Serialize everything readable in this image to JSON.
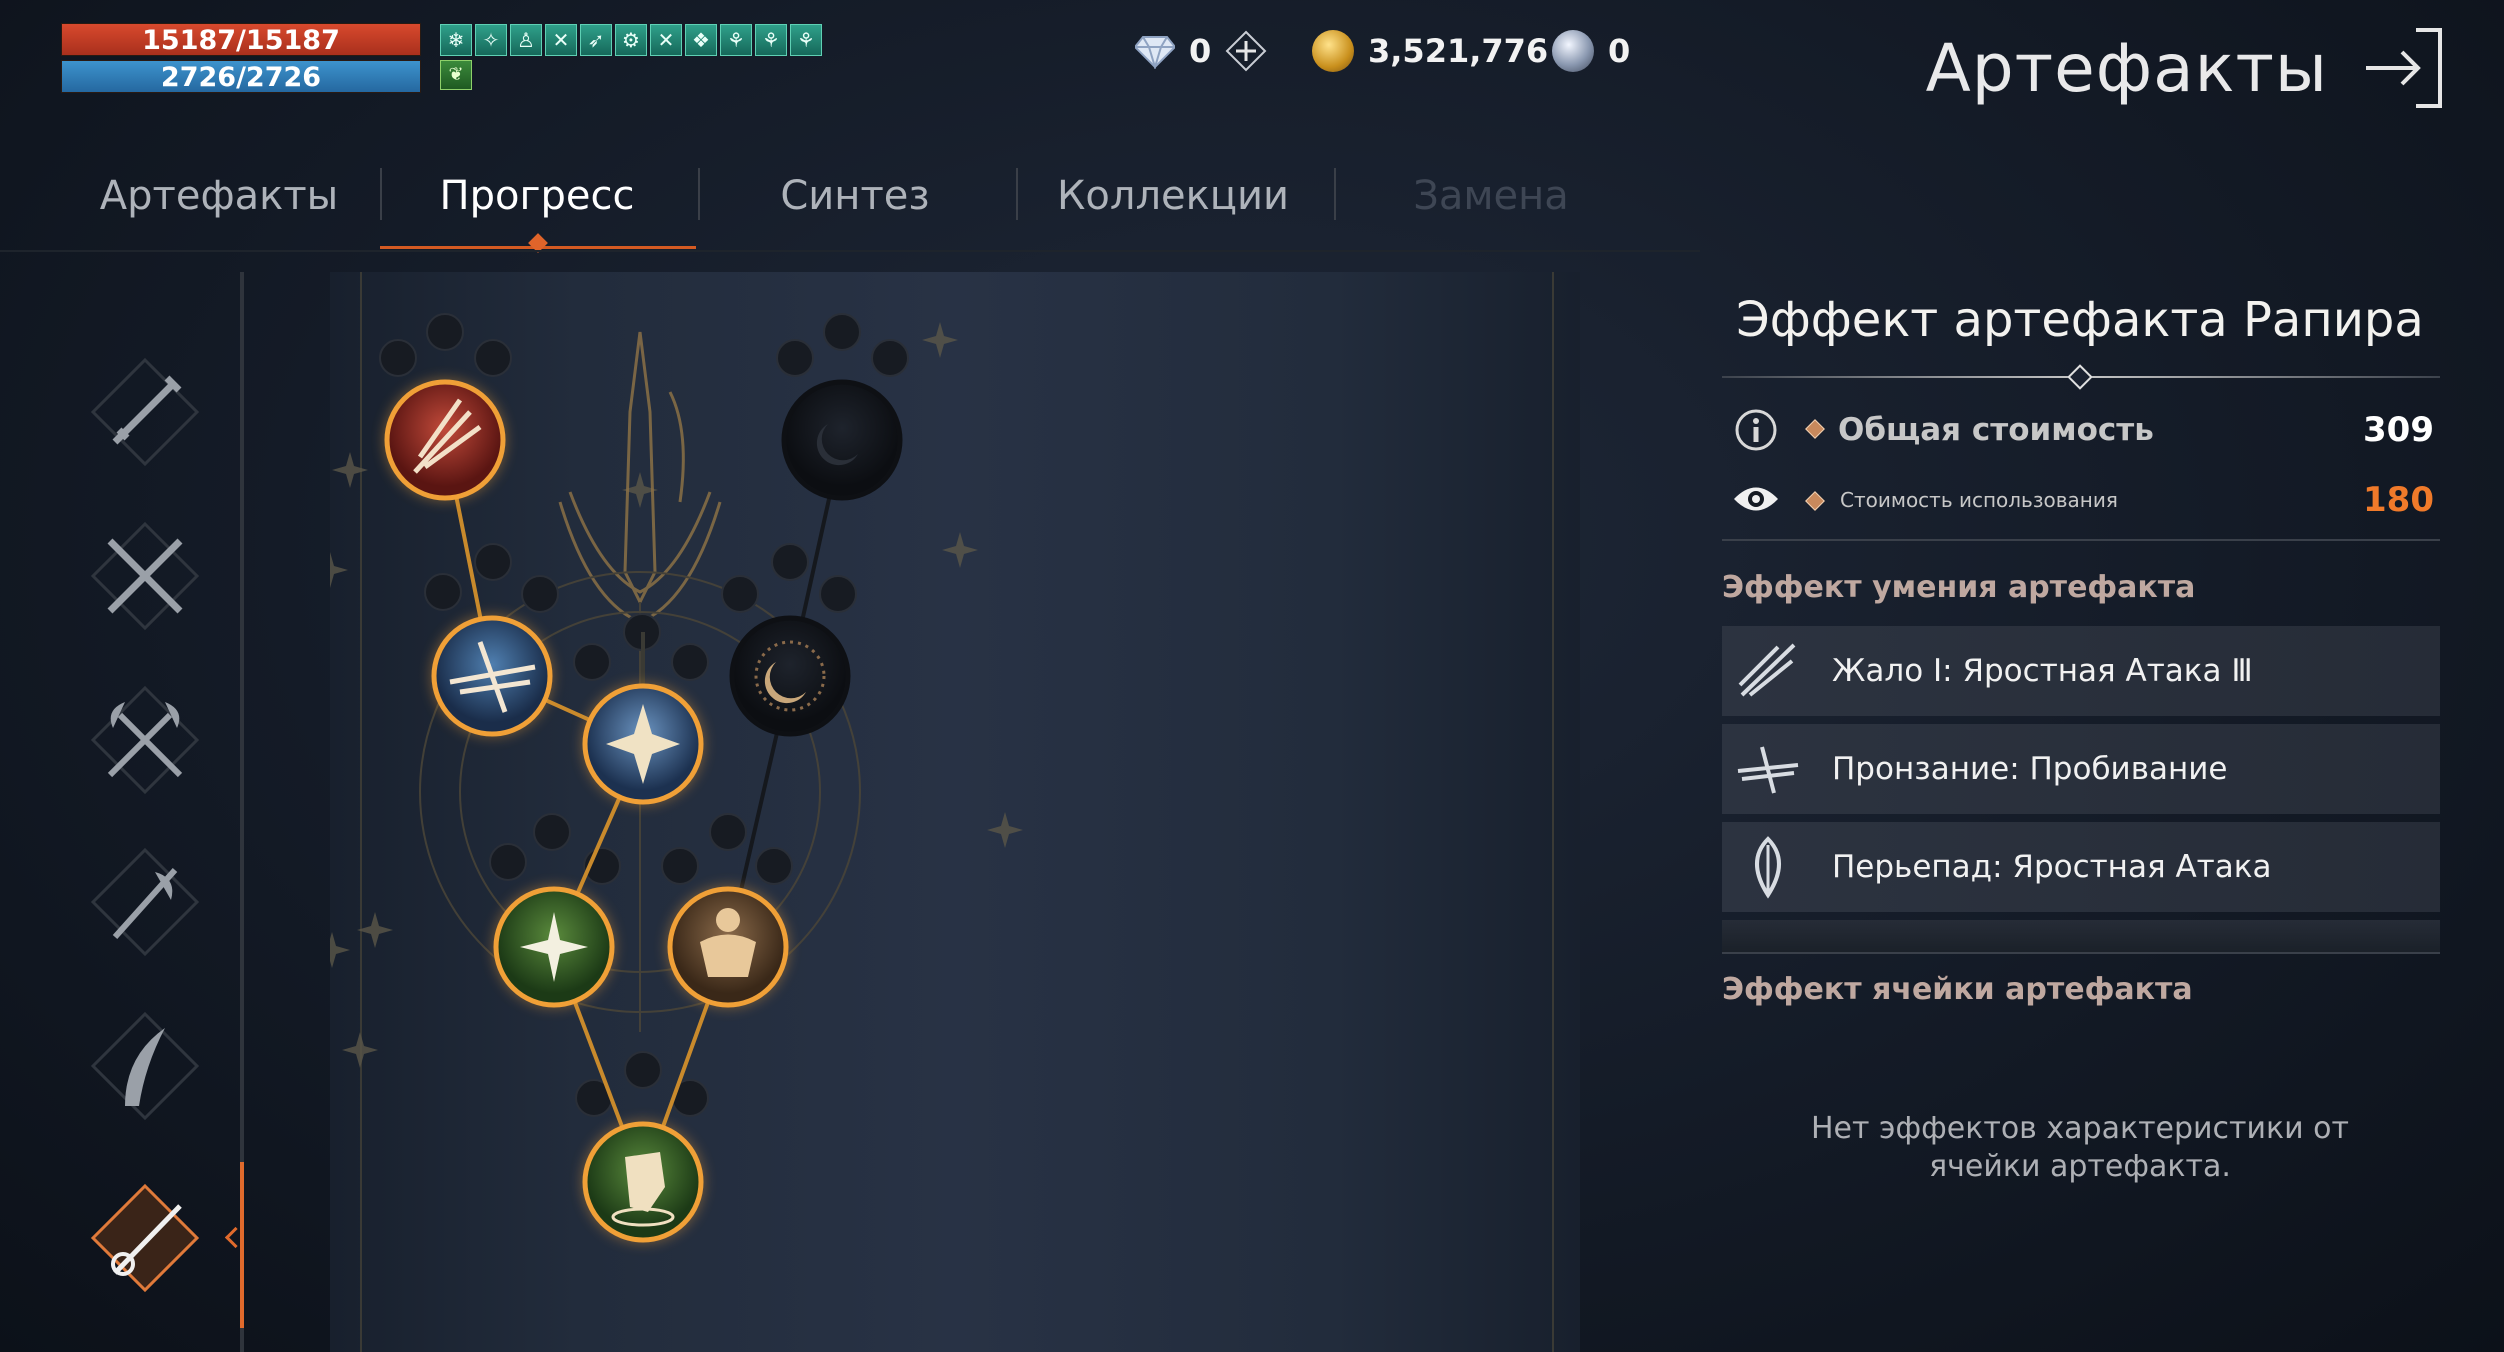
{
  "status": {
    "hp": "15187/15187",
    "mp": "2726/2726",
    "hp_fraction": 1.0,
    "mp_fraction": 1.0,
    "buff_icons": [
      "❄",
      "✧",
      "♙",
      "✕",
      "➶",
      "⚙",
      "✕",
      "❖",
      "⚘",
      "⚘",
      "⚘"
    ],
    "extra_buff_icon": "❦"
  },
  "currencies": {
    "diamonds": "0",
    "gold": "3,521,776",
    "silver": "0"
  },
  "page_title": "Артефакты",
  "tabs": [
    {
      "label": "Артефакты"
    },
    {
      "label": "Прогресс"
    },
    {
      "label": "Синтез"
    },
    {
      "label": "Коллекции"
    },
    {
      "label": "Замена"
    }
  ],
  "weapon_categories": [
    "sword-icon",
    "crossed-swords-icon",
    "crossed-axes-icon",
    "halberd-icon",
    "scimitar-icon",
    "rapier-icon"
  ],
  "tree_nodes": [
    {
      "name": "red-blades-node",
      "state": "active"
    },
    {
      "name": "moon-node-top",
      "state": "locked"
    },
    {
      "name": "blue-blades-node",
      "state": "active"
    },
    {
      "name": "moon-node-mid",
      "state": "locked"
    },
    {
      "name": "center-burst-node",
      "state": "active"
    },
    {
      "name": "green-star-node",
      "state": "active"
    },
    {
      "name": "warrior-node",
      "state": "active"
    },
    {
      "name": "fist-node",
      "state": "active"
    }
  ],
  "effect_panel": {
    "title": "Эффект артефакта Рапира",
    "total_cost_label": "Общая стоимость",
    "total_cost_value": "309",
    "use_cost_label": "Стоимость использования",
    "use_cost_value": "180",
    "skill_effect_header": "Эффект умения артефакта",
    "skills": [
      {
        "label": "Жало Ⅰ: Яростная Атака Ⅲ"
      },
      {
        "label": "Пронзание: Пробивание"
      },
      {
        "label": "Перьепад: Яростная Атака"
      }
    ],
    "cell_effect_header": "Эффект ячейки артефакта",
    "cell_effect_empty": "Нет эффектов характеристики от ячейки артефакта."
  },
  "colors": {
    "accent": "#e06a2c",
    "use_cost": "#f07a2a",
    "hp_bar": "#c83b24",
    "mp_bar": "#2f7fbc",
    "node_ring": "#f0a037"
  }
}
